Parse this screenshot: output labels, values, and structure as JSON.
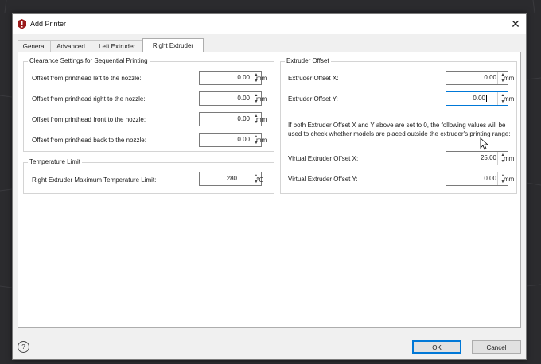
{
  "window": {
    "title": "Add Printer",
    "close_glyph": "✕"
  },
  "tabs": [
    {
      "label": "General"
    },
    {
      "label": "Advanced"
    },
    {
      "label": "Left Extruder"
    },
    {
      "label": "Right Extruder",
      "active": true
    }
  ],
  "clearance": {
    "title": "Clearance Settings for Sequential Printing",
    "rows": [
      {
        "label": "Offset from printhead left to the nozzle:",
        "value": "0.00",
        "unit": "mm"
      },
      {
        "label": "Offset from printhead right to the nozzle:",
        "value": "0.00",
        "unit": "mm"
      },
      {
        "label": "Offset from printhead front to the nozzle:",
        "value": "0.00",
        "unit": "mm"
      },
      {
        "label": "Offset from printhead back to the nozzle:",
        "value": "0.00",
        "unit": "mm"
      }
    ]
  },
  "temperature": {
    "title": "Temperature Limit",
    "label": "Right Extruder Maximum Temperature Limit:",
    "value": "280",
    "unit": "℃"
  },
  "extruder_offset": {
    "title": "Extruder Offset",
    "x_label": "Extruder Offset X:",
    "x_value": "0.00",
    "x_unit": "mm",
    "y_label": "Extruder Offset Y:",
    "y_value": "0.00",
    "y_unit": "mm",
    "note_line1": "If both Extruder Offset X and Y above are set to 0, the following values will be",
    "note_line2": "used to check whether models are placed outside the extruder's printing range:",
    "vx_label": "Virtual Extruder Offset X:",
    "vx_value": "25.00",
    "vx_unit": "mm",
    "vy_label": "Virtual Extruder Offset Y:",
    "vy_value": "0.00",
    "vy_unit": "mm"
  },
  "footer": {
    "help_glyph": "?",
    "ok_label": "OK",
    "cancel_label": "Cancel"
  },
  "icons": {
    "app": "printer-logo-icon",
    "close": "close-icon",
    "help": "help-icon",
    "spin": "spin-arrows-icon",
    "cursor": "mouse-cursor-icon"
  },
  "colors": {
    "focus_accent": "#0078d7",
    "app_icon": "#9b1b1b",
    "background": "#2b2b2e"
  }
}
